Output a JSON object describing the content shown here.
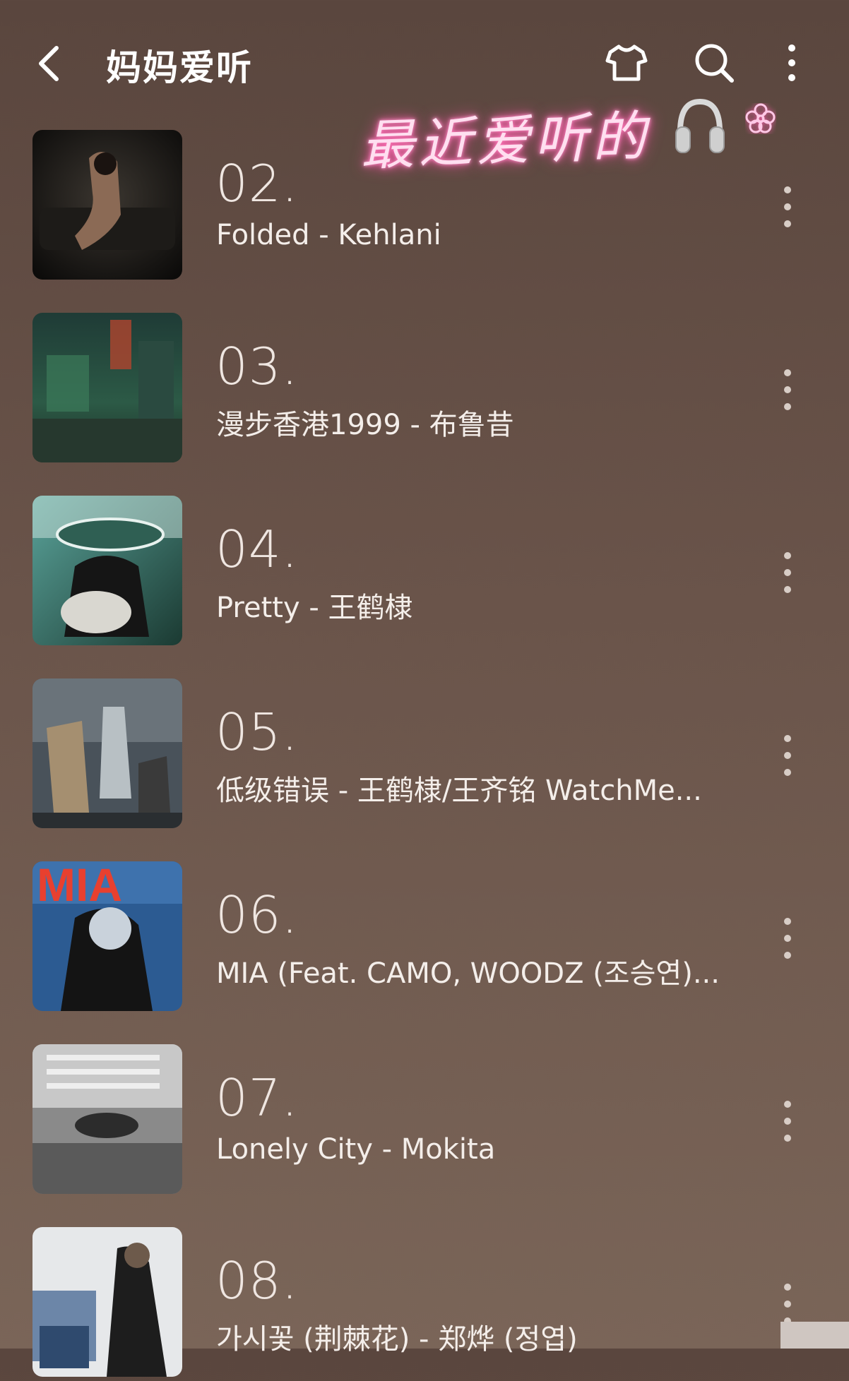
{
  "header": {
    "title": "妈妈爱听"
  },
  "decoration": {
    "handwritten_text": "最近爱听的"
  },
  "songs": [
    {
      "num": "02.",
      "title": "Folded - Kehlani"
    },
    {
      "num": "03.",
      "title": "漫步香港1999 - 布鲁昔"
    },
    {
      "num": "04.",
      "title": "Pretty - 王鹤棣"
    },
    {
      "num": "05.",
      "title": "低级错误 - 王鹤棣/王齐铭 WatchMe..."
    },
    {
      "num": "06.",
      "title": "MIA (Feat. CAMO, WOODZ (조승연)..."
    },
    {
      "num": "07.",
      "title": "Lonely City - Mokita"
    },
    {
      "num": "08.",
      "title": "가시꽃 (荆棘花) - 郑烨 (정엽)"
    }
  ],
  "icons": {
    "back": "chevron-left-icon",
    "shirt": "shirt-icon",
    "search": "search-icon",
    "more": "more-vertical-icon",
    "headphones": "headphones-icon",
    "flower": "flower-icon"
  },
  "colors": {
    "accent_neon_pink": "#ff6fb6",
    "background": "#6a544a"
  }
}
